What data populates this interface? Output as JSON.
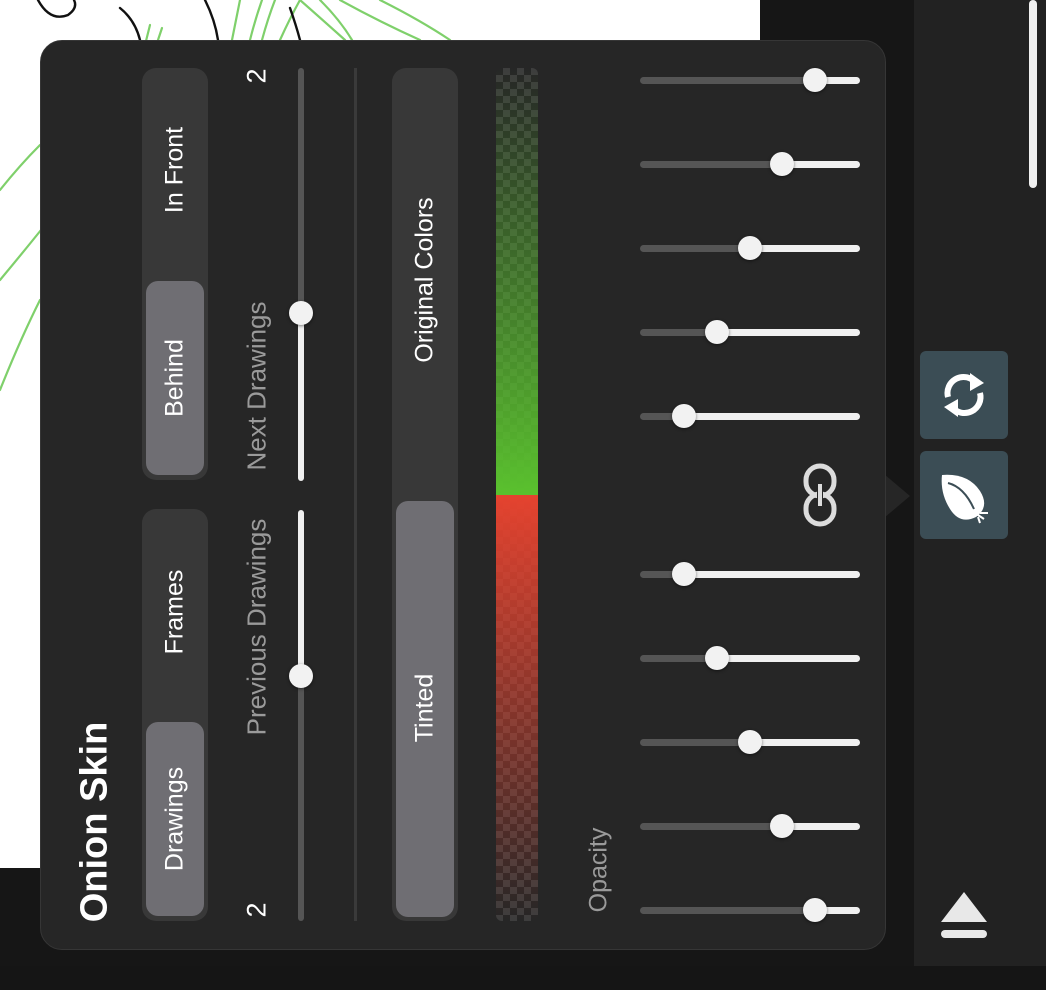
{
  "panel": {
    "title": "Onion Skin",
    "mode_toggle": {
      "options": [
        "Drawings",
        "Frames"
      ],
      "selected": "Drawings"
    },
    "position_toggle": {
      "options": [
        "Behind",
        "In Front"
      ],
      "selected": "Behind"
    },
    "previous_drawings": {
      "label": "Previous Drawings",
      "count": "2"
    },
    "next_drawings": {
      "label": "Next Drawings",
      "count": "2"
    },
    "color_toggle": {
      "options": [
        "Tinted",
        "Original Colors"
      ],
      "selected": "Tinted"
    },
    "tint_colors": {
      "previous": "#e5432f",
      "next": "#5ac12e"
    },
    "opacity": {
      "label": "Opacity",
      "previous_levels": [
        0.8,
        0.65,
        0.5,
        0.35,
        0.2
      ],
      "next_levels": [
        0.2,
        0.35,
        0.5,
        0.65,
        0.8
      ],
      "linked": true
    }
  },
  "icons": {
    "sync": "sync-icon",
    "onion": "onion-icon",
    "link": "link-icon",
    "eject": "eject-icon"
  },
  "colors": {
    "accent_button": "#3b4d55",
    "panel_background": "#262626",
    "selected_segment": "#6f6e73"
  }
}
